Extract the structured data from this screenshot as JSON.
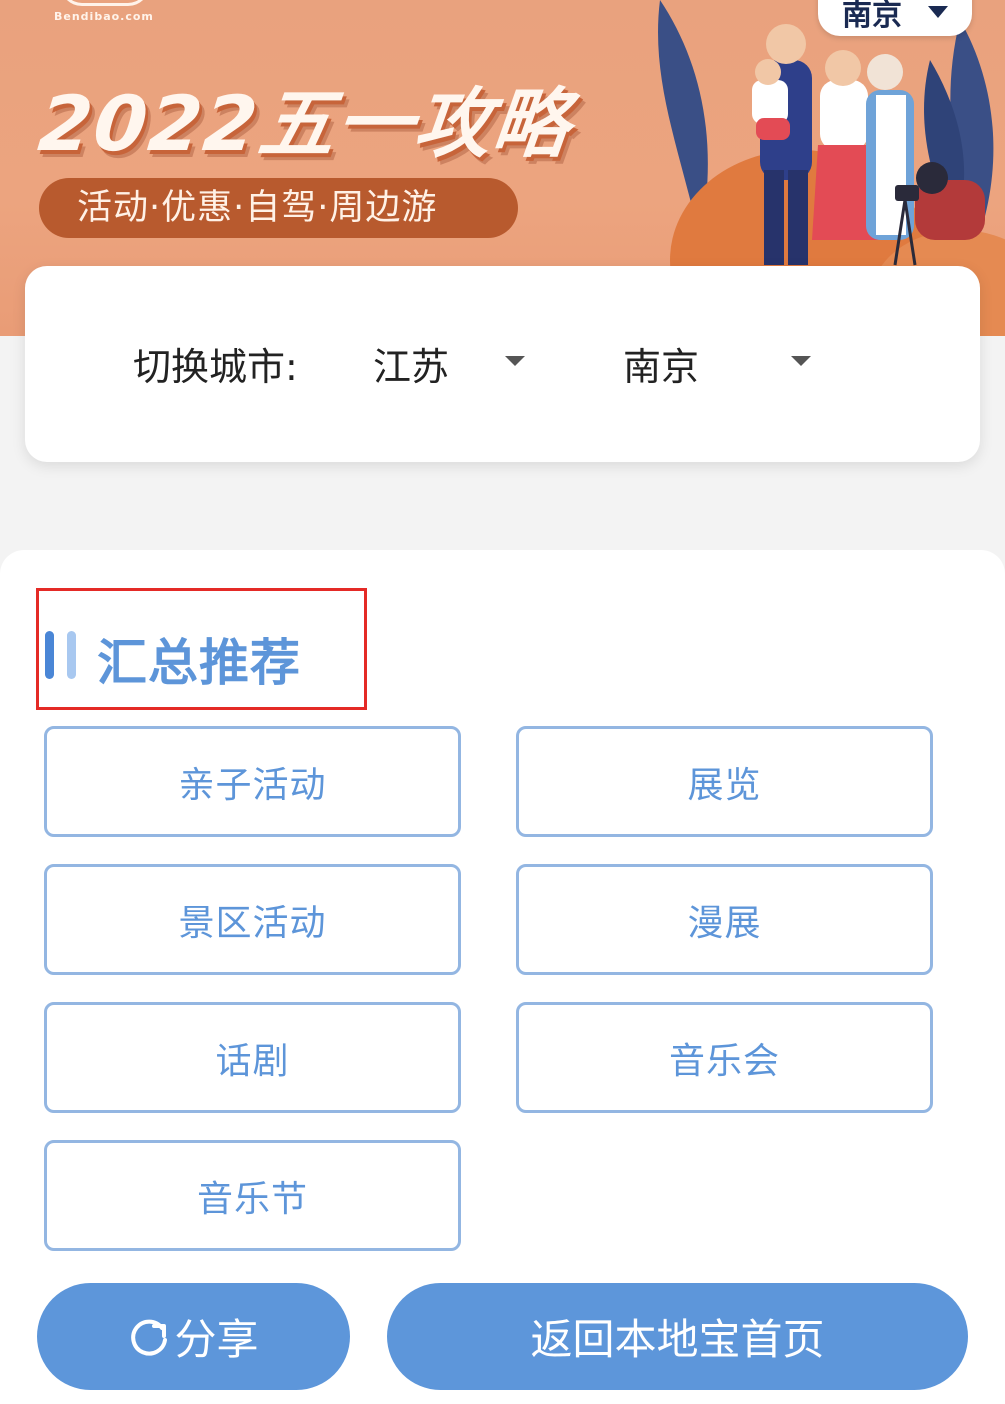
{
  "banner": {
    "site_logo": "Bendibao.com",
    "title": "2022五一攻略",
    "tagline": "活动·优惠·自驾·周边游",
    "city_chip": "南京"
  },
  "city_switch": {
    "label": "切换城市:",
    "province": "江苏",
    "city": "南京"
  },
  "summary": {
    "title": "汇总推荐",
    "items": [
      {
        "label": "亲子活动"
      },
      {
        "label": "展览"
      },
      {
        "label": "景区活动"
      },
      {
        "label": "漫展"
      },
      {
        "label": "话剧"
      },
      {
        "label": "音乐会"
      },
      {
        "label": "音乐节"
      }
    ]
  },
  "actions": {
    "share": "分享",
    "home": "返回本地宝首页"
  },
  "colors": {
    "banner": "#eca47f",
    "pill": "#b85a2e",
    "accent": "#5d96da",
    "button_border": "#93b6e2",
    "highlight_box": "#e42a26"
  }
}
